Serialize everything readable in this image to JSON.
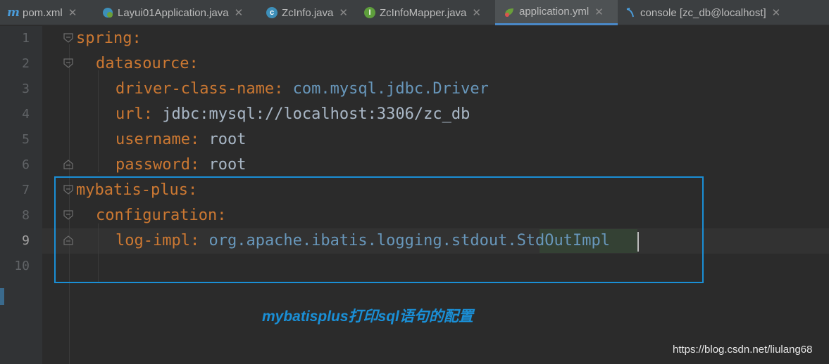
{
  "tabs": [
    {
      "label": "pom.xml",
      "icon": "maven-icon",
      "active": false
    },
    {
      "label": "Layui01Application.java",
      "icon": "spring-boot-class-icon",
      "active": false
    },
    {
      "label": "ZcInfo.java",
      "icon": "class-icon",
      "active": false
    },
    {
      "label": "ZcInfoMapper.java",
      "icon": "interface-icon",
      "active": false
    },
    {
      "label": "application.yml",
      "icon": "spring-yaml-icon",
      "active": true
    },
    {
      "label": "console [zc_db@localhost]",
      "icon": "database-console-icon",
      "active": false
    }
  ],
  "tab_close_glyph": "✕",
  "icon_letters": {
    "maven": "m",
    "class": "c",
    "interface": "I"
  },
  "line_numbers": [
    "1",
    "2",
    "3",
    "4",
    "5",
    "6",
    "7",
    "8",
    "9",
    "10"
  ],
  "current_line": "9",
  "code": {
    "l1": {
      "key": "spring",
      "colon": ":"
    },
    "l2": {
      "key": "datasource",
      "colon": ":"
    },
    "l3": {
      "key": "driver-class-name",
      "colon": ":",
      "value": "com.mysql.jdbc.Driver"
    },
    "l4": {
      "key": "url",
      "colon": ":",
      "value": "jdbc:mysql://localhost:3306/zc_db"
    },
    "l5": {
      "key": "username",
      "colon": ":",
      "value": "root"
    },
    "l6": {
      "key": "password",
      "colon": ":",
      "value": "root"
    },
    "l7": {
      "key": "mybatis-plus",
      "colon": ":"
    },
    "l8": {
      "key": "configuration",
      "colon": ":"
    },
    "l9": {
      "key": "log-impl",
      "colon": ":",
      "value_prefix": "org.apache.ibatis.logging.stdout.",
      "value_highlight": "StdOutImpl"
    }
  },
  "caption": "mybatisplus打印sql语句的配置",
  "watermark": "https://blog.csdn.net/liulang68",
  "colors": {
    "editor_bg": "#2b2b2b",
    "key": "#cc7832",
    "value": "#a9b7c6",
    "annotation_blue": "#1a8fd6"
  }
}
